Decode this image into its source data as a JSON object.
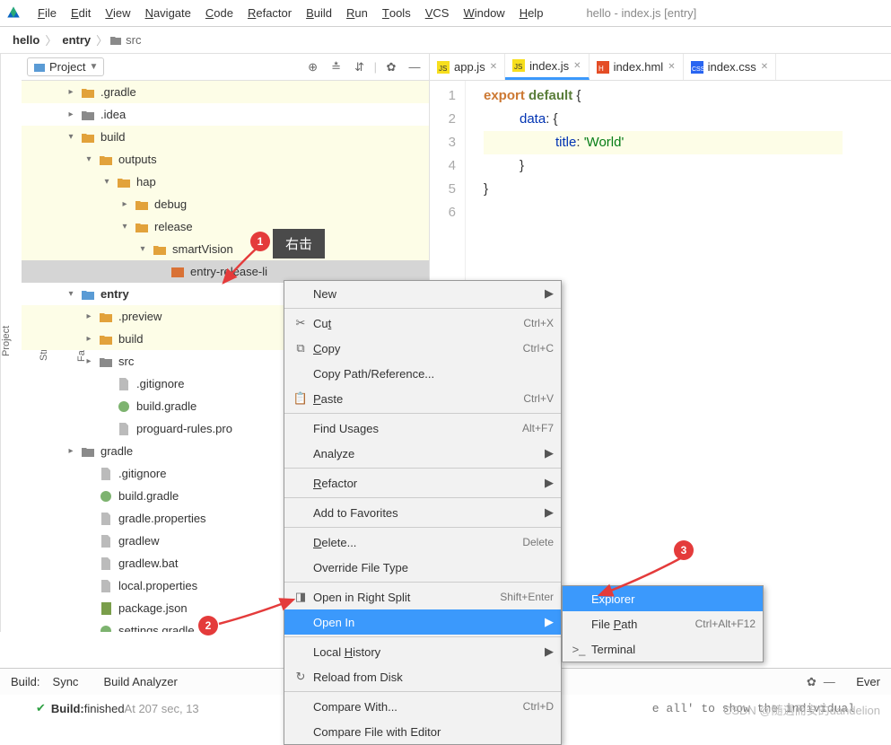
{
  "menubar": {
    "items": [
      "File",
      "Edit",
      "View",
      "Navigate",
      "Code",
      "Refactor",
      "Build",
      "Run",
      "Tools",
      "VCS",
      "Window",
      "Help"
    ],
    "title": "hello - index.js [entry]"
  },
  "breadcrumb": {
    "a": "hello",
    "b": "entry",
    "c": "src"
  },
  "project": {
    "title": "Project"
  },
  "tree": {
    "rows": [
      {
        "d": 2,
        "exp": "r",
        "icon": "fy",
        "label": ".gradle",
        "hl": true
      },
      {
        "d": 2,
        "exp": "r",
        "icon": "fg",
        "label": ".idea"
      },
      {
        "d": 2,
        "exp": "d",
        "icon": "fy",
        "label": "build",
        "hl": true
      },
      {
        "d": 3,
        "exp": "d",
        "icon": "fy",
        "label": "outputs",
        "hl": true
      },
      {
        "d": 4,
        "exp": "d",
        "icon": "fy",
        "label": "hap",
        "hl": true
      },
      {
        "d": 5,
        "exp": "r",
        "icon": "fy",
        "label": "debug",
        "hl": true
      },
      {
        "d": 5,
        "exp": "d",
        "icon": "fy",
        "label": "release",
        "hl": true
      },
      {
        "d": 6,
        "exp": "d",
        "icon": "fy",
        "label": "smartVision",
        "hl": true
      },
      {
        "d": 7,
        "exp": "",
        "icon": "hap",
        "label": "entry-release-li",
        "sel": true
      },
      {
        "d": 2,
        "exp": "d",
        "icon": "fb",
        "label": "entry",
        "bold": true
      },
      {
        "d": 3,
        "exp": "r",
        "icon": "fy",
        "label": ".preview",
        "hl": true
      },
      {
        "d": 3,
        "exp": "r",
        "icon": "fy",
        "label": "build",
        "hl": true
      },
      {
        "d": 3,
        "exp": "r",
        "icon": "fg",
        "label": "src"
      },
      {
        "d": 4,
        "exp": "",
        "icon": "file",
        "label": ".gitignore"
      },
      {
        "d": 4,
        "exp": "",
        "icon": "gradle",
        "label": "build.gradle"
      },
      {
        "d": 4,
        "exp": "",
        "icon": "file",
        "label": "proguard-rules.pro"
      },
      {
        "d": 2,
        "exp": "r",
        "icon": "fg",
        "label": "gradle"
      },
      {
        "d": 3,
        "exp": "",
        "icon": "file",
        "label": ".gitignore"
      },
      {
        "d": 3,
        "exp": "",
        "icon": "gradle",
        "label": "build.gradle"
      },
      {
        "d": 3,
        "exp": "",
        "icon": "file",
        "label": "gradle.properties"
      },
      {
        "d": 3,
        "exp": "",
        "icon": "file",
        "label": "gradlew"
      },
      {
        "d": 3,
        "exp": "",
        "icon": "file",
        "label": "gradlew.bat"
      },
      {
        "d": 3,
        "exp": "",
        "icon": "file",
        "label": "local.properties"
      },
      {
        "d": 3,
        "exp": "",
        "icon": "json",
        "label": "package.json"
      },
      {
        "d": 3,
        "exp": "",
        "icon": "gradle",
        "label": "settings.gradle"
      }
    ]
  },
  "tabs": [
    {
      "icon": "js",
      "label": "app.js",
      "active": false
    },
    {
      "icon": "js",
      "label": "index.js",
      "active": true
    },
    {
      "icon": "hml",
      "label": "index.hml",
      "active": false
    },
    {
      "icon": "css",
      "label": "index.css",
      "active": false
    }
  ],
  "code": {
    "lines": [
      "1",
      "2",
      "3",
      "4",
      "5",
      "6"
    ],
    "l1a": "export",
    "l1b": "default",
    "l1c": "{",
    "l2a": "data",
    "l2b": ": {",
    "l3a": "title",
    "l3b": ": ",
    "l3c": "'World'",
    "l4": "}",
    "l5": "}"
  },
  "cm1": [
    {
      "type": "row",
      "icon": "",
      "label": "New",
      "arr": true
    },
    {
      "type": "sep"
    },
    {
      "type": "row",
      "icon": "✂",
      "label": "Cut",
      "short": "Ctrl+X",
      "u": 2
    },
    {
      "type": "row",
      "icon": "⧉",
      "label": "Copy",
      "short": "Ctrl+C",
      "u": 0
    },
    {
      "type": "row",
      "icon": "",
      "label": "Copy Path/Reference..."
    },
    {
      "type": "row",
      "icon": "📋",
      "label": "Paste",
      "short": "Ctrl+V",
      "u": 0
    },
    {
      "type": "sep"
    },
    {
      "type": "row",
      "icon": "",
      "label": "Find Usages",
      "short": "Alt+F7"
    },
    {
      "type": "row",
      "icon": "",
      "label": "Analyze",
      "arr": true
    },
    {
      "type": "sep"
    },
    {
      "type": "row",
      "icon": "",
      "label": "Refactor",
      "arr": true,
      "u": 0
    },
    {
      "type": "sep"
    },
    {
      "type": "row",
      "icon": "",
      "label": "Add to Favorites",
      "arr": true
    },
    {
      "type": "sep"
    },
    {
      "type": "row",
      "icon": "",
      "label": "Delete...",
      "short": "Delete",
      "u": 0
    },
    {
      "type": "row",
      "icon": "",
      "label": "Override File Type"
    },
    {
      "type": "sep"
    },
    {
      "type": "row",
      "icon": "◨",
      "label": "Open in Right Split",
      "short": "Shift+Enter"
    },
    {
      "type": "row",
      "icon": "",
      "label": "Open In",
      "arr": true,
      "hover": true
    },
    {
      "type": "sep"
    },
    {
      "type": "row",
      "icon": "",
      "label": "Local History",
      "arr": true,
      "u": 6
    },
    {
      "type": "row",
      "icon": "↻",
      "label": "Reload from Disk"
    },
    {
      "type": "sep"
    },
    {
      "type": "row",
      "icon": "",
      "label": "Compare With...",
      "short": "Ctrl+D"
    },
    {
      "type": "row",
      "icon": "",
      "label": "Compare File with Editor"
    }
  ],
  "cm2": [
    {
      "type": "row",
      "icon": "",
      "label": "Explorer",
      "hover": true
    },
    {
      "type": "row",
      "icon": "",
      "label": "File Path",
      "short": "Ctrl+Alt+F12",
      "u": 5
    },
    {
      "type": "row",
      "icon": ">_",
      "label": "Terminal"
    }
  ],
  "annotations": {
    "b1": "1",
    "b2": "2",
    "b3": "3",
    "tip": "右击"
  },
  "build": {
    "sync": "Sync",
    "analyzer": "Build Analyzer",
    "status_a": "Build:",
    "status_b": " finished",
    "status_c": " At 20 ",
    "status_d": "7 sec, 13",
    "tail": "e all' to show the individual",
    "ever": "Ever"
  },
  "sidestrip": {
    "a": "Project",
    "b": "Structure",
    "c": "Favorites"
  },
  "watermark": "CSDN @随遇而安的dandelion"
}
